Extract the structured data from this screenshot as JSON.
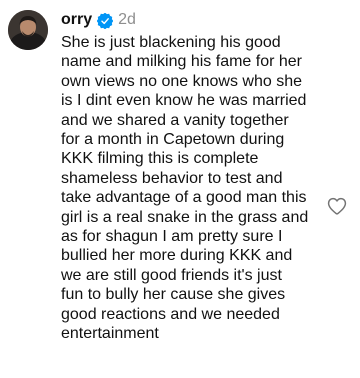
{
  "comment": {
    "username": "orry",
    "verified_icon": "verified-badge-icon",
    "timestamp": "2d",
    "text": "She is just blackening his good\nname and milking his fame for her\nown views no one knows who she\nis I dint even know he was married\nand we shared a vanity together\nfor a month in Capetown during\nKKK filming this is complete\nshameless behavior to test and\ntake advantage of a good man this\ngirl is a real snake in the grass and\nas for shagun I am pretty sure I\nbullied her more during KKK and\nwe are still good friends it's just\nfun to bully her cause she gives\ngood reactions and we needed\nentertainment",
    "like_icon": "heart-outline-icon"
  },
  "colors": {
    "verified_blue": "#0095f6",
    "timestamp_gray": "#8e8e8e",
    "text": "#111111",
    "heart_gray": "#737373"
  }
}
